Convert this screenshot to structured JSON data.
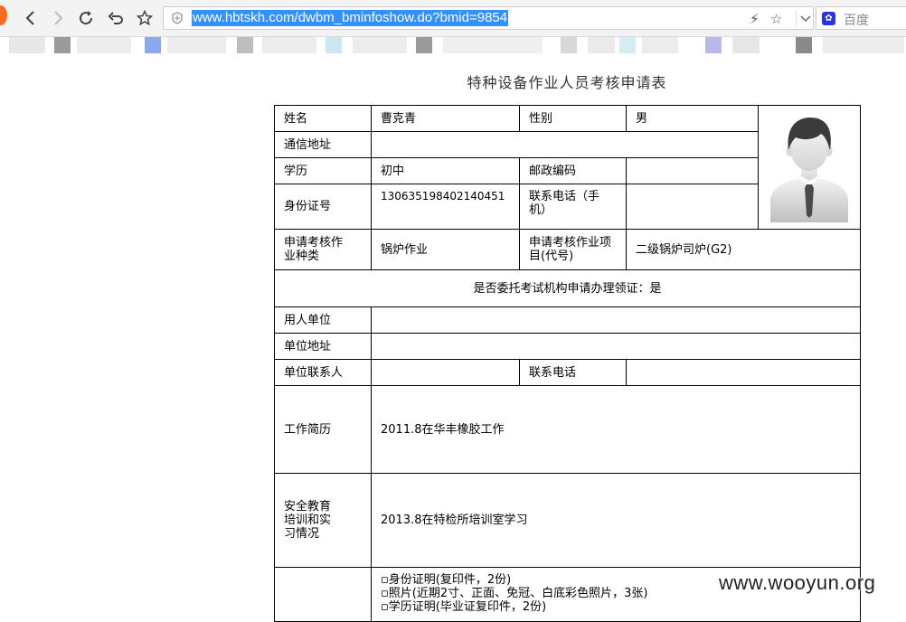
{
  "browser": {
    "url": "www.hbtskh.com/dwbm_bminfoshow.do?bmid=9854",
    "search_placeholder": "百度"
  },
  "page": {
    "title": "特种设备作业人员考核申请表"
  },
  "form": {
    "name_label": "姓名",
    "name_value": "曹克青",
    "gender_label": "性别",
    "gender_value": "男",
    "address_label": "通信地址",
    "address_value": "",
    "education_label": "学历",
    "education_value": "初中",
    "postcode_label": "邮政编码",
    "postcode_value": "",
    "id_label": "身份证号",
    "id_value": "130635198402140451",
    "phone_label": "联系电话（手机）",
    "phone_value": "",
    "category_label": "申请考核作业种类",
    "category_value": "锅炉作业",
    "project_label": "申请考核作业项目(代号)",
    "project_value": "二级锅炉司炉(G2)",
    "entrust_text": "是否委托考试机构申请办理领证：是",
    "employer_label": "用人单位",
    "employer_value": "",
    "employer_address_label": "单位地址",
    "employer_address_value": "",
    "contact_person_label": "单位联系人",
    "contact_person_value": "",
    "contact_phone_label": "联系电话",
    "contact_phone_value": "",
    "work_history_label": "工作简历",
    "work_history_value": "2011.8在华丰橡胶工作",
    "training_label": "安全教育培训和实习情况",
    "training_value": "2013.8在特检所培训室学习",
    "documents": [
      "▫身份证明(复印件，2份)",
      "▫照片(近期2寸、正面、免冠、白底彩色照片，3张)",
      "▫学历证明(毕业证复印件，2份)"
    ]
  },
  "watermark": "www.wooyun.org"
}
